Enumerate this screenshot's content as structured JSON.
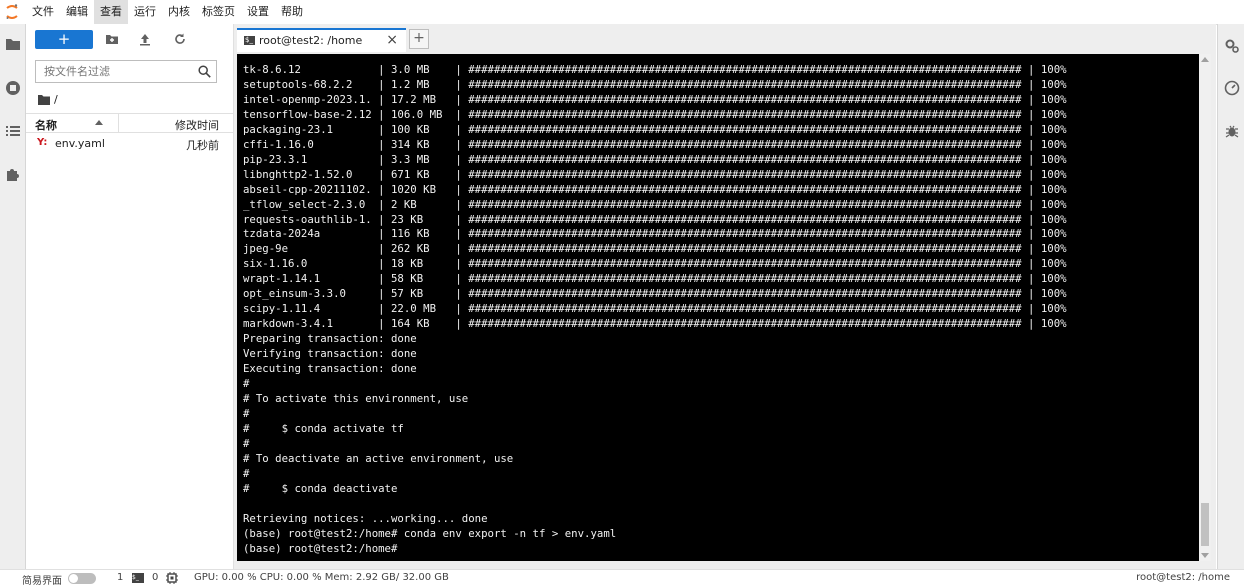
{
  "menubar": {
    "items": [
      "文件",
      "编辑",
      "查看",
      "运行",
      "内核",
      "标签页",
      "设置",
      "帮助"
    ],
    "active_index": 2
  },
  "file_browser": {
    "new_button_label": "+",
    "search_placeholder": "按文件名过滤",
    "breadcrumb": "/",
    "columns": {
      "name": "名称",
      "modified": "修改时间"
    },
    "files": [
      {
        "icon": "yaml-file-icon",
        "icon_text": "Y:",
        "name": "env.yaml",
        "modified": "几秒前"
      }
    ]
  },
  "tabs": [
    {
      "label": "root@test2: /home",
      "icon": "terminal-icon",
      "icon_text": "$_",
      "close": "×"
    }
  ],
  "add_tab_label": "+",
  "terminal": {
    "lines": [
      "tk-8.6.12            | 3.0 MB    | ###################################################################################### | 100%",
      "setuptools-68.2.2    | 1.2 MB    | ###################################################################################### | 100%",
      "intel-openmp-2023.1. | 17.2 MB   | ###################################################################################### | 100%",
      "tensorflow-base-2.12 | 106.0 MB  | ###################################################################################### | 100%",
      "packaging-23.1       | 100 KB    | ###################################################################################### | 100%",
      "cffi-1.16.0          | 314 KB    | ###################################################################################### | 100%",
      "pip-23.3.1           | 3.3 MB    | ###################################################################################### | 100%",
      "libnghttp2-1.52.0    | 671 KB    | ###################################################################################### | 100%",
      "abseil-cpp-20211102. | 1020 KB   | ###################################################################################### | 100%",
      "_tflow_select-2.3.0  | 2 KB      | ###################################################################################### | 100%",
      "requests-oauthlib-1. | 23 KB     | ###################################################################################### | 100%",
      "tzdata-2024a         | 116 KB    | ###################################################################################### | 100%",
      "jpeg-9e              | 262 KB    | ###################################################################################### | 100%",
      "six-1.16.0           | 18 KB     | ###################################################################################### | 100%",
      "wrapt-1.14.1         | 58 KB     | ###################################################################################### | 100%",
      "opt_einsum-3.3.0     | 57 KB     | ###################################################################################### | 100%",
      "scipy-1.11.4         | 22.0 MB   | ###################################################################################### | 100%",
      "markdown-3.4.1       | 164 KB    | ###################################################################################### | 100%",
      "Preparing transaction: done",
      "Verifying transaction: done",
      "Executing transaction: done",
      "#",
      "# To activate this environment, use",
      "#",
      "#     $ conda activate tf",
      "#",
      "# To deactivate an active environment, use",
      "#",
      "#     $ conda deactivate",
      "",
      "Retrieving notices: ...working... done",
      "(base) root@test2:/home# conda env export -n tf > env.yaml",
      "(base) root@test2:/home# "
    ]
  },
  "status_bar": {
    "simple_mode_label": "简易界面",
    "terminals_count": "1",
    "terminal_icon_text": "$_",
    "kernels_count": "0",
    "resources": "GPU: 0.00 % CPU: 0.00 % Mem: 2.92 GB/ 32.00 GB",
    "right_text": "root@test2: /home"
  }
}
